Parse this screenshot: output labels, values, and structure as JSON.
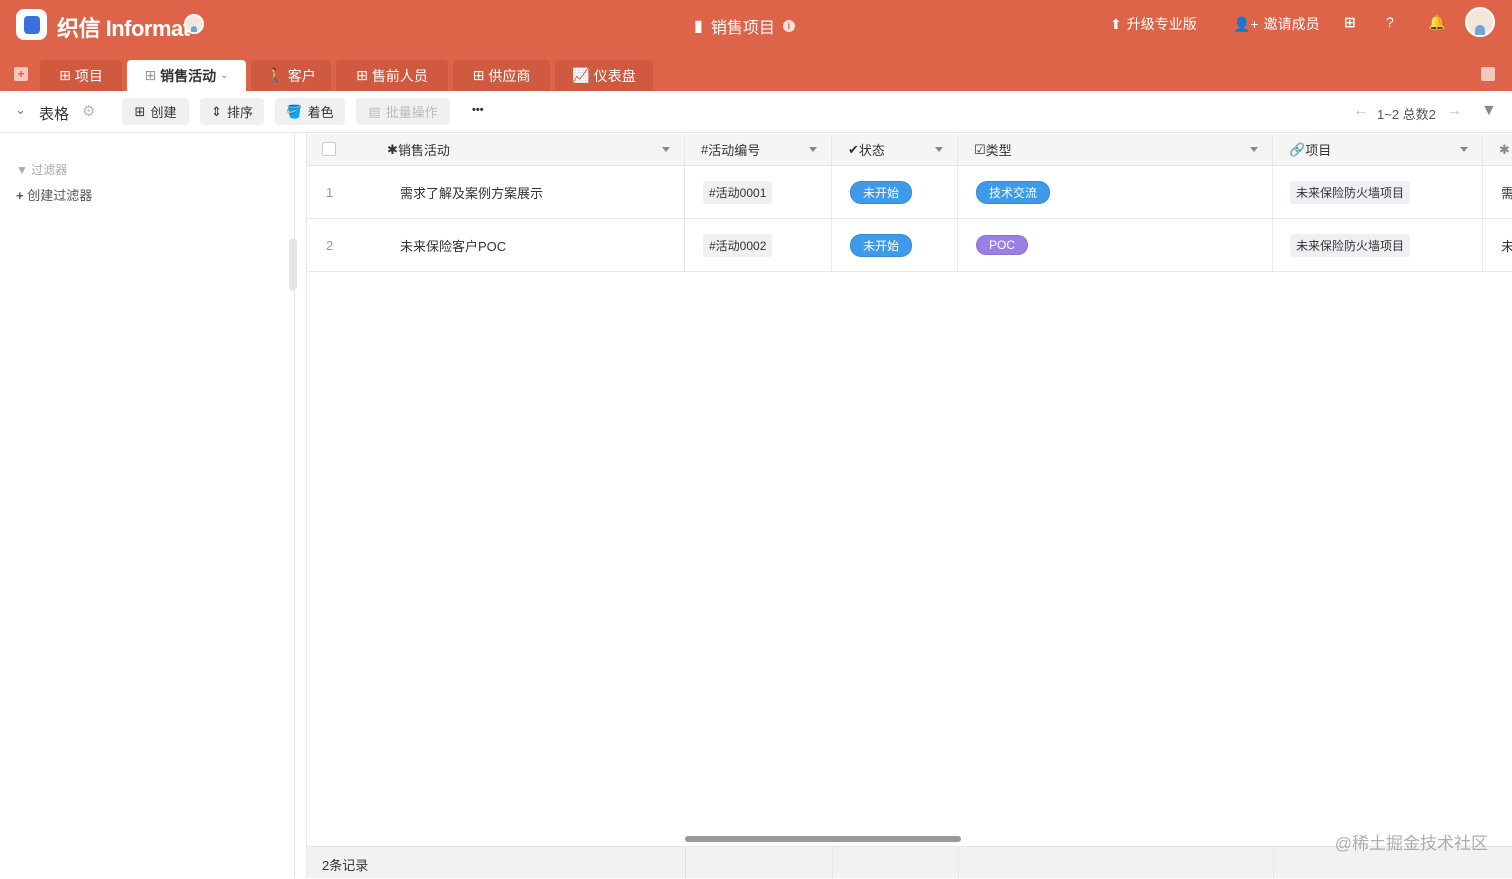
{
  "header": {
    "brand": "织信 Informat",
    "title": "销售项目",
    "upgrade": "升级专业版",
    "invite": "邀请成员"
  },
  "tabs": [
    {
      "label": "项目"
    },
    {
      "label": "销售活动"
    },
    {
      "label": "客户"
    },
    {
      "label": "售前人员"
    },
    {
      "label": "供应商"
    },
    {
      "label": "仪表盘"
    }
  ],
  "toolbar": {
    "view": "表格",
    "create": "创建",
    "sort": "排序",
    "color": "着色",
    "batch": "批量操作",
    "more": "•••",
    "pager": "1~2 总数2"
  },
  "sidebar": {
    "filter_title": "过滤器",
    "create_filter": "创建过滤器"
  },
  "table": {
    "columns": [
      "销售活动",
      "活动编号",
      "状态",
      "类型",
      "项目"
    ],
    "rows": [
      {
        "num": "1",
        "name": "需求了解及案例方案展示",
        "code": "#活动0001",
        "status": "未开始",
        "type": "技术交流",
        "project": "未来保险防火墙项目",
        "extra": "需"
      },
      {
        "num": "2",
        "name": "未来保险客户POC",
        "code": "#活动0002",
        "status": "未开始",
        "type": "POC",
        "project": "未来保险防火墙项目",
        "extra": "未"
      }
    ],
    "footer": "2条记录"
  },
  "watermark": "@稀土掘金技术社区",
  "colors": {
    "brand": "#dd6449",
    "status_blue": "#3d9be9",
    "poc_purple": "#9b7fe6"
  }
}
